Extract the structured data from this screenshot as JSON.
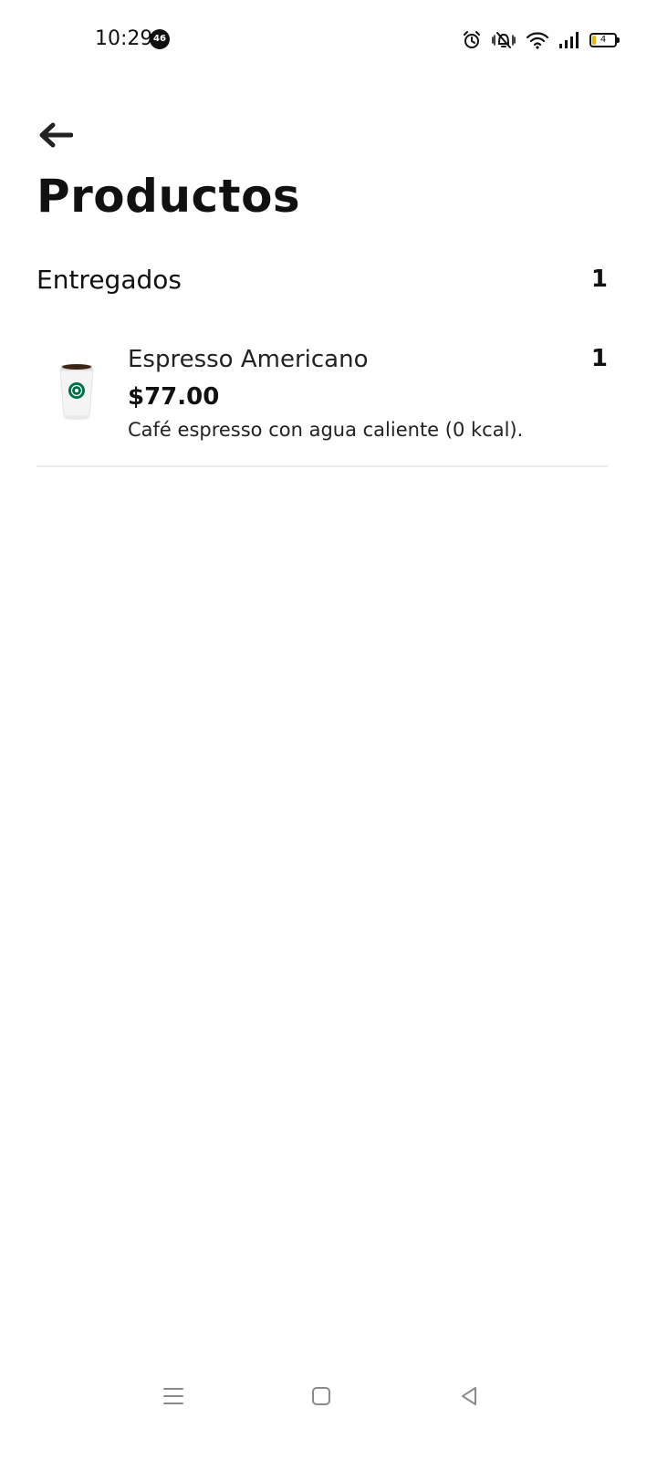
{
  "status_bar": {
    "time": "10:29",
    "notification_badge": "46",
    "battery_level": "4",
    "battery_fraction": 0.15
  },
  "header": {
    "back_icon": "arrow-left-icon",
    "title": "Productos"
  },
  "section": {
    "title": "Entregados",
    "count": "1"
  },
  "products": [
    {
      "name": "Espresso Americano",
      "price": "$77.00",
      "description": "Café espresso con agua caliente (0 kcal).",
      "quantity": "1",
      "image_icon": "coffee-cup-icon"
    }
  ],
  "nav_bar": {
    "menu_icon": "menu-icon",
    "home_icon": "home-square-icon",
    "back_icon": "back-triangle-icon"
  },
  "colors": {
    "text": "#111111",
    "divider": "#ececec",
    "cup_logo": "#00704a"
  }
}
